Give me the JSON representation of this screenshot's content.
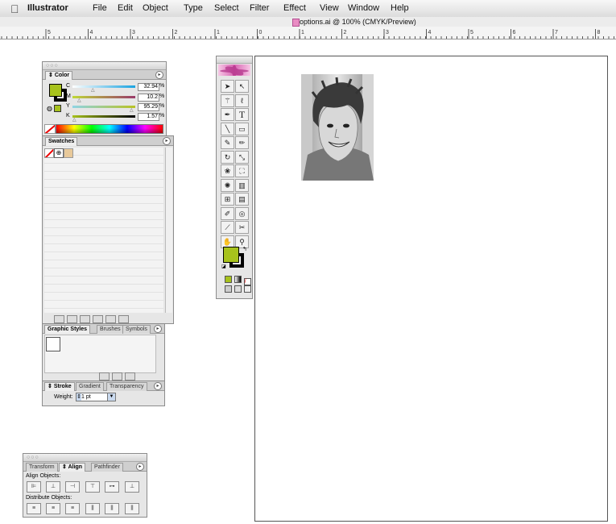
{
  "menubar": {
    "app": "Illustrator",
    "items": [
      "File",
      "Edit",
      "Object",
      "Type",
      "Select",
      "Filter",
      "Effect",
      "View",
      "Window",
      "Help"
    ]
  },
  "document": {
    "title": "options.ai @ 100% (CMYK/Preview)"
  },
  "ruler": {
    "labels": [
      "5",
      "4",
      "3",
      "2",
      "1",
      "0",
      "1",
      "2",
      "3",
      "4",
      "5",
      "6",
      "7",
      "8"
    ]
  },
  "color_panel": {
    "tab": "Color",
    "channels": [
      {
        "label": "C",
        "value": "32.94",
        "unit": "%"
      },
      {
        "label": "M",
        "value": "10.2",
        "unit": "%"
      },
      {
        "label": "Y",
        "value": "95.29",
        "unit": "%"
      },
      {
        "label": "K",
        "value": "1.57",
        "unit": "%"
      }
    ],
    "fill_color": "#a7c21c"
  },
  "swatches_panel": {
    "tab": "Swatches"
  },
  "styles_panel": {
    "tabs": [
      "Graphic Styles",
      "Brushes",
      "Symbols"
    ]
  },
  "stroke_panel": {
    "tabs": [
      "Stroke",
      "Gradient",
      "Transparency"
    ],
    "weight_label": "Weight:",
    "weight_value": "1 pt"
  },
  "align_panel": {
    "tabs": [
      "Transform",
      "Align",
      "Pathfinder"
    ],
    "align_label": "Align Objects:",
    "distribute_label": "Distribute Objects:"
  },
  "tools": {
    "type_glyph": "T",
    "icons": [
      "selection-icon",
      "direct-selection-icon",
      "magic-wand-icon",
      "lasso-icon",
      "pen-icon",
      "type-icon",
      "line-icon",
      "rectangle-icon",
      "paintbrush-icon",
      "pencil-icon",
      "rotate-icon",
      "scale-icon",
      "warp-icon",
      "free-transform-icon",
      "symbol-sprayer-icon",
      "graph-icon",
      "mesh-icon",
      "gradient-icon",
      "eyedropper-icon",
      "blend-icon",
      "slice-icon",
      "scissors-icon",
      "hand-icon",
      "zoom-icon"
    ]
  }
}
